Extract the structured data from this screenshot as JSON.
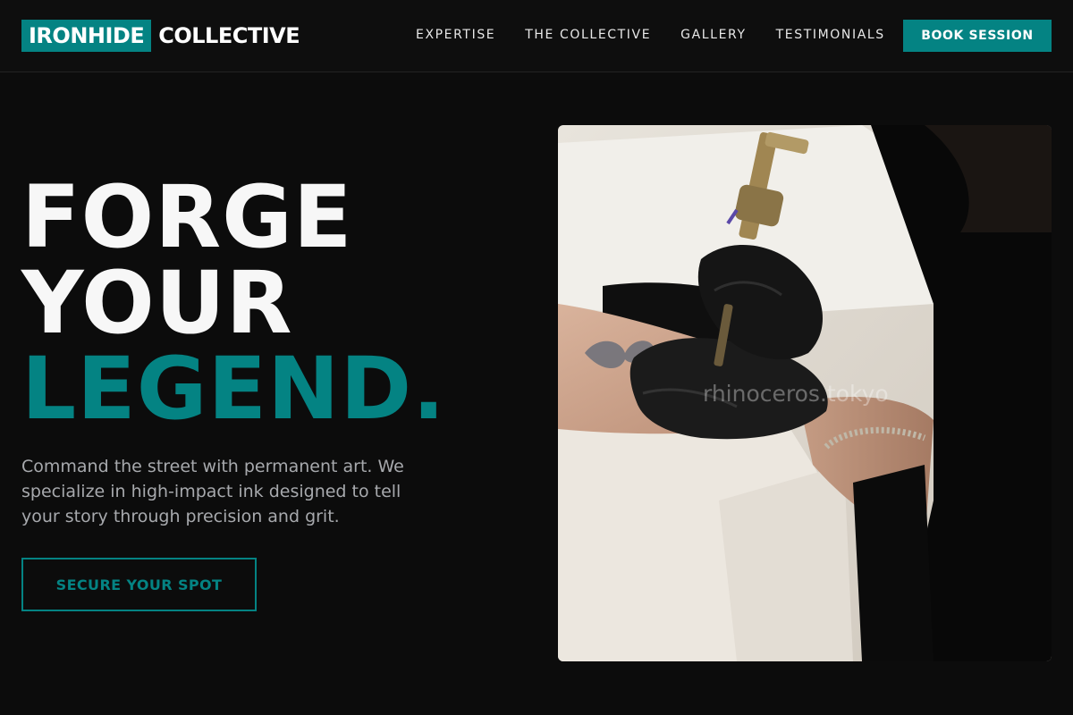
{
  "brand": {
    "highlight": "IRONHIDE",
    "rest": "COLLECTIVE",
    "accent_color": "#048383"
  },
  "nav": {
    "links": [
      "EXPERTISE",
      "THE COLLECTIVE",
      "GALLERY",
      "TESTIMONIALS"
    ],
    "cta_label": "BOOK SESSION"
  },
  "hero": {
    "title_lines": [
      "FORGE",
      "YOUR"
    ],
    "title_accent": "LEGEND.",
    "description": "Command the street with permanent art. We specialize in high-impact ink designed to tell your story through precision and grit.",
    "cta_label": "SECURE YOUR SPOT",
    "image_watermark": "rhinoceros.tokyo"
  }
}
